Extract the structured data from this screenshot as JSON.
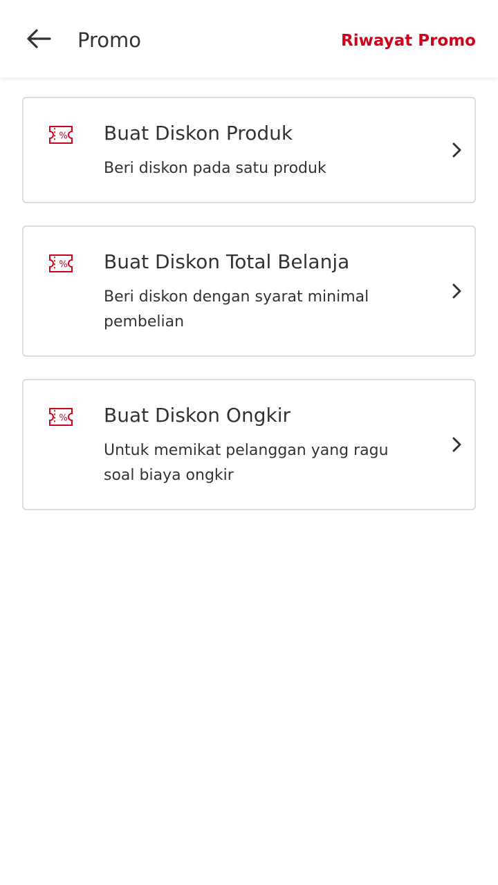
{
  "header": {
    "title": "Promo",
    "history_link": "Riwayat Promo",
    "back_icon": "arrow-left-icon"
  },
  "colors": {
    "accent": "#d0021b",
    "text": "#333333",
    "border": "#dcdcdc"
  },
  "promo_options": [
    {
      "title": "Buat Diskon Produk",
      "description": "Beri diskon pada satu produk",
      "icon": "discount-coupon-icon"
    },
    {
      "title": "Buat Diskon Total Belanja",
      "description": "Beri diskon dengan syarat minimal pembelian",
      "icon": "discount-coupon-icon"
    },
    {
      "title": "Buat Diskon Ongkir",
      "description": "Untuk memikat pelanggan yang ragu soal biaya ongkir",
      "icon": "discount-coupon-icon"
    }
  ]
}
